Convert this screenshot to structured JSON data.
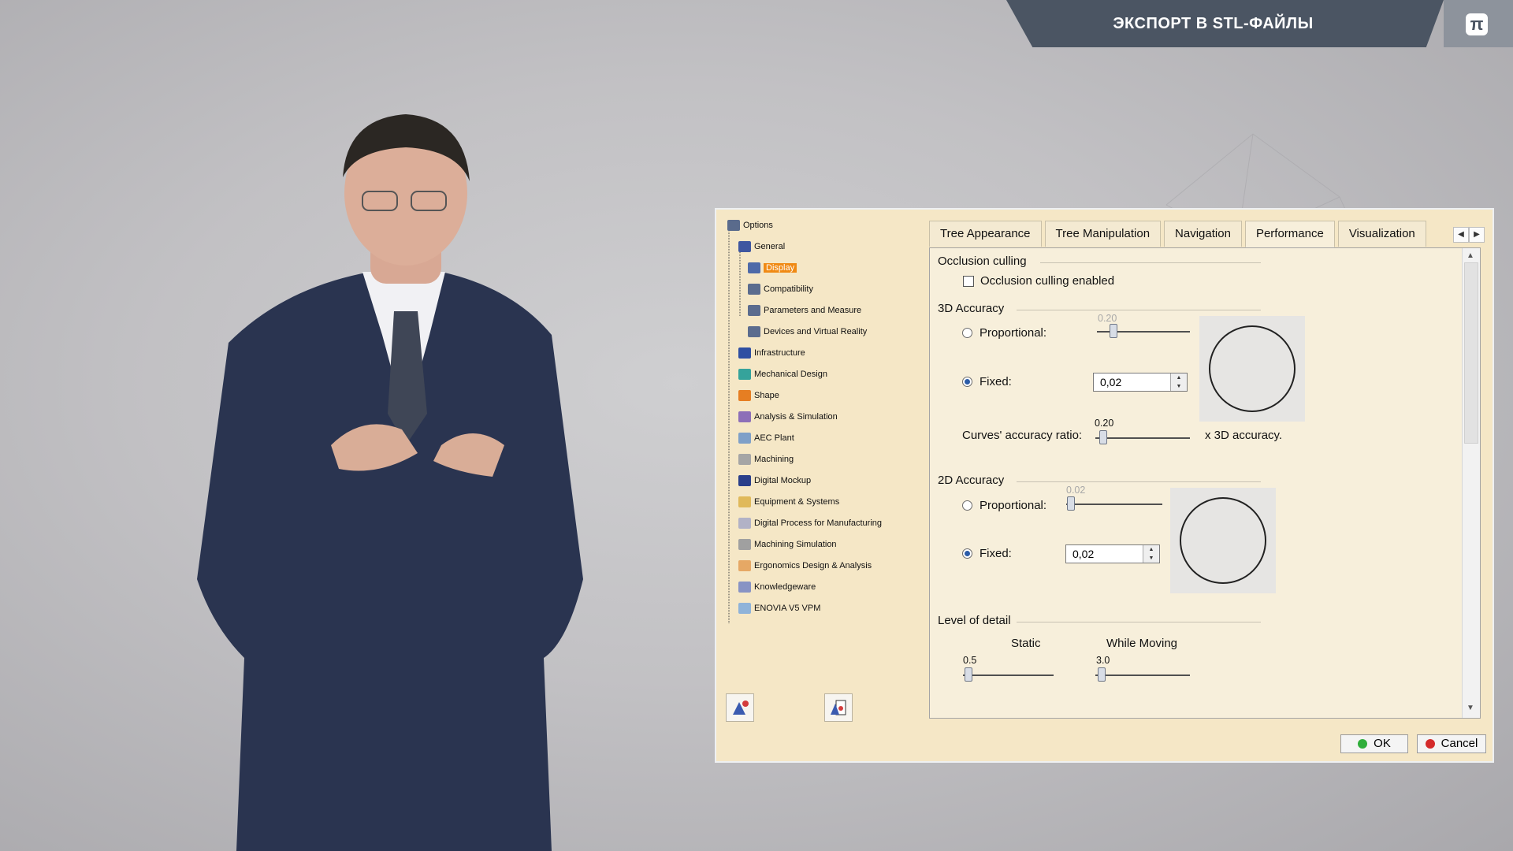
{
  "banner": {
    "title": "ЭКСПОРТ В STL-ФАЙЛЫ",
    "logo": "π"
  },
  "tree": {
    "items": [
      {
        "label": "Options",
        "level": 0,
        "icon_color": "#5a6b8c"
      },
      {
        "label": "General",
        "level": 1,
        "icon_color": "#3f57a0"
      },
      {
        "label": "Display",
        "level": 2,
        "icon_color": "#4e6aa8",
        "selected": true
      },
      {
        "label": "Compatibility",
        "level": 2,
        "icon_color": "#5b6c8e"
      },
      {
        "label": "Parameters and Measure",
        "level": 2,
        "icon_color": "#5b6c8e"
      },
      {
        "label": "Devices and Virtual Reality",
        "level": 2,
        "icon_color": "#5b6c8e"
      },
      {
        "label": "Infrastructure",
        "level": 1,
        "icon_color": "#2f4fa2"
      },
      {
        "label": "Mechanical Design",
        "level": 1,
        "icon_color": "#35a39b"
      },
      {
        "label": "Shape",
        "level": 1,
        "icon_color": "#e67e22"
      },
      {
        "label": "Analysis & Simulation",
        "level": 1,
        "icon_color": "#8d6fb8"
      },
      {
        "label": "AEC Plant",
        "level": 1,
        "icon_color": "#7fa0c8"
      },
      {
        "label": "Machining",
        "level": 1,
        "icon_color": "#a5a5a5"
      },
      {
        "label": "Digital Mockup",
        "level": 1,
        "icon_color": "#2a3f8a"
      },
      {
        "label": "Equipment & Systems",
        "level": 1,
        "icon_color": "#e0b95a"
      },
      {
        "label": "Digital Process for Manufacturing",
        "level": 1,
        "icon_color": "#b2b2c6"
      },
      {
        "label": "Machining Simulation",
        "level": 1,
        "icon_color": "#a0a0a0"
      },
      {
        "label": "Ergonomics Design & Analysis",
        "level": 1,
        "icon_color": "#e6a865"
      },
      {
        "label": "Knowledgeware",
        "level": 1,
        "icon_color": "#8893c4"
      },
      {
        "label": "ENOVIA V5 VPM",
        "level": 1,
        "icon_color": "#8fb3d9"
      }
    ],
    "bottom_buttons": [
      {
        "name": "reset-icon"
      },
      {
        "name": "dump-parameters-icon"
      }
    ]
  },
  "tabs": [
    "Tree Appearance",
    "Tree Manipulation",
    "Navigation",
    "Performance",
    "Visualization"
  ],
  "active_tab_index": 3,
  "occlusion": {
    "section": "Occlusion culling",
    "checkbox_label": "Occlusion culling enabled",
    "checked": false
  },
  "acc3d": {
    "section": "3D Accuracy",
    "proportional_label": "Proportional:",
    "proportional_value": "0.20",
    "fixed_label": "Fixed:",
    "fixed_value": "0,02",
    "curves_label": "Curves' accuracy ratio:",
    "curves_value": "0.20",
    "curves_suffix": "x 3D accuracy."
  },
  "acc2d": {
    "section": "2D Accuracy",
    "proportional_label": "Proportional:",
    "proportional_value": "0.02",
    "fixed_label": "Fixed:",
    "fixed_value": "0,02"
  },
  "lod": {
    "section": "Level of detail",
    "static_label": "Static",
    "static_value": "0.5",
    "moving_label": "While Moving",
    "moving_value": "3.0"
  },
  "buttons": {
    "ok": "OK",
    "cancel": "Cancel"
  },
  "colors": {
    "dialog_bg": "#f5e7c6",
    "selection": "#f08a14",
    "ok_dot": "#2fae3a",
    "cancel_dot": "#d42a2a"
  }
}
